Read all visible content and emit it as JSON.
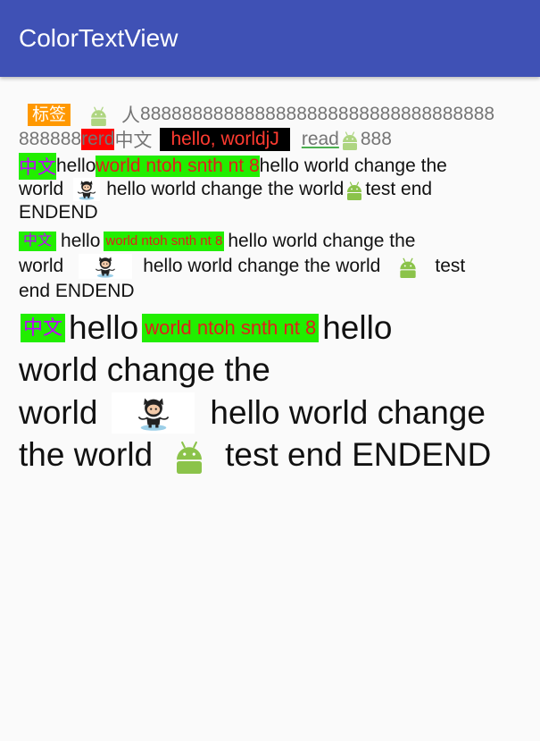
{
  "appbar": {
    "title": "ColorTextView"
  },
  "block1": {
    "tag": "标签",
    "person": "人",
    "eights_a": "8888888888888888888888888888888888",
    "eights_b": "888888",
    "red_text": "rerd",
    "zh": "中文",
    "black_text": "hello, worldjJ",
    "link": "read",
    "tail": "888"
  },
  "block2": {
    "zh": "中文",
    "hello": "hello",
    "green_text": "world ntoh snth nt 8",
    "change": "hello world change the",
    "world": "world",
    "change2": "hello world change the world",
    "test_end": "test end",
    "endend": "ENDEND"
  },
  "block3": {
    "zh": "中文",
    "hello": "hello",
    "green_text": "world ntoh snth nt 8",
    "change": "hello world change the",
    "world": "world",
    "change2": "hello world change the world",
    "test": "test",
    "end": "end ENDEND"
  },
  "block4": {
    "zh": "中文",
    "hello": "hello",
    "green_text": "world ntoh snth nt 8",
    "hello2": "hello",
    "world_change": "world change the",
    "world": "world",
    "hello_world_change": "hello world change",
    "the_world": "the world",
    "test_end": "test end ENDEND"
  },
  "colors": {
    "appbar": "#3f51b5",
    "tag_bg": "#ff9800",
    "red_bg": "#ff0000",
    "black_bg": "#000000",
    "green_bg": "#22ee00",
    "purple_text": "#c000ff",
    "android_green": "#a4c639"
  },
  "icons": [
    "android-icon",
    "octocat-icon"
  ]
}
